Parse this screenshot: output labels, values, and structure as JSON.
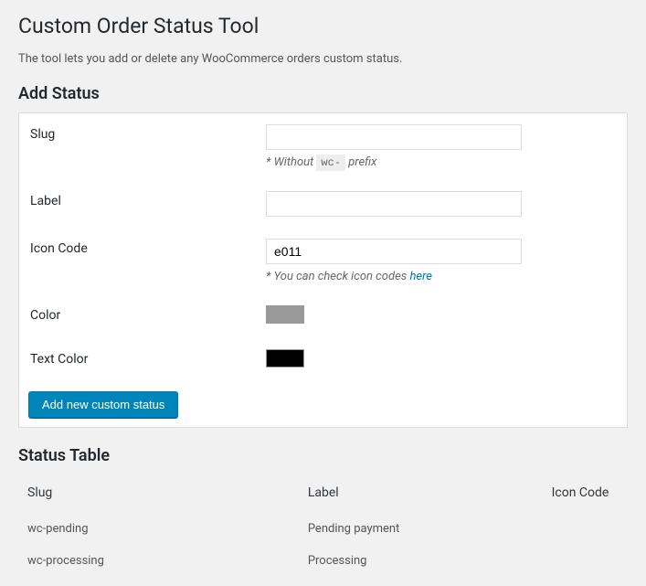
{
  "page": {
    "title": "Custom Order Status Tool",
    "description": "The tool lets you add or delete any WooCommerce orders custom status."
  },
  "form": {
    "heading": "Add Status",
    "fields": {
      "slug": {
        "label": "Slug",
        "value": "",
        "help_prefix": "* Without ",
        "help_code": "wc-",
        "help_suffix": " prefix"
      },
      "label": {
        "label": "Label",
        "value": ""
      },
      "icon_code": {
        "label": "Icon Code",
        "value": "e011",
        "help_text": "* You can check icon codes ",
        "help_link": "here"
      },
      "color": {
        "label": "Color",
        "value": "#999999"
      },
      "text_color": {
        "label": "Text Color",
        "value": "#000000"
      }
    },
    "submit_label": "Add new custom status"
  },
  "status_table": {
    "heading": "Status Table",
    "columns": {
      "slug": "Slug",
      "label": "Label",
      "icon_code": "Icon Code"
    },
    "rows": [
      {
        "slug": "wc-pending",
        "label": "Pending payment",
        "icon_code": ""
      },
      {
        "slug": "wc-processing",
        "label": "Processing",
        "icon_code": ""
      }
    ]
  }
}
